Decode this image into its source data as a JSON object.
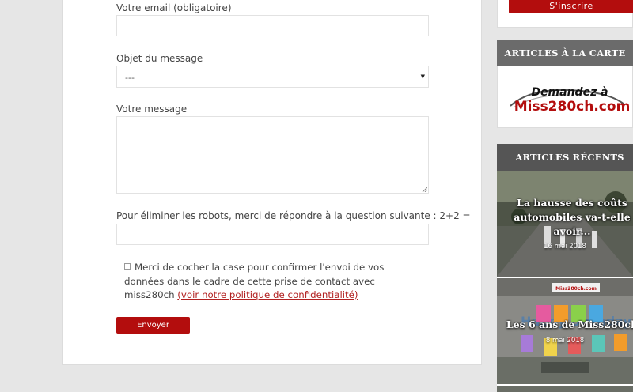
{
  "form": {
    "email_label": "Votre email (obligatoire)",
    "email_value": "",
    "subject_label": "Objet du message",
    "subject_selected": "---",
    "message_label": "Votre message",
    "message_value": "",
    "robot_label": "Pour éliminer les robots, merci de répondre à la question suivante : 2+2 =",
    "robot_value": "",
    "consent_text": "Merci de cocher la case pour confirmer l'envoi de vos données dans le cadre de cette prise de contact avec miss280ch",
    "consent_link": "(voir notre politique de confidentialité)",
    "consent_checked": false,
    "submit_label": "Envoyer"
  },
  "sidebar": {
    "signup_label": "S'inscrire",
    "carte_heading": "ARTICLES À LA CARTE",
    "ad_line1": "Demandez à",
    "ad_line2": "Miss280ch.com",
    "recent_heading": "ARTICLES RÉCENTS",
    "articles": [
      {
        "title_l1": "La hausse des coûts",
        "title_l2": "automobiles va-t-elle",
        "title_l3": "avoir...",
        "date": "16 mai 2018"
      },
      {
        "title_l1": "Les 6 ans de Miss280ch",
        "date": "8 mai 2018",
        "banner": "Miss280ch.com",
        "cake_letters": "Happy Birthday"
      }
    ]
  },
  "colors": {
    "accent": "#b30d0d",
    "link": "#b22222",
    "widget_header": "#6b6b6b",
    "page_bg": "#e6e6e6"
  }
}
